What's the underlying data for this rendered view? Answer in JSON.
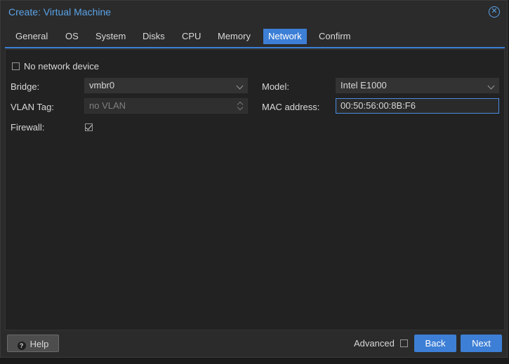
{
  "window": {
    "title": "Create: Virtual Machine",
    "close_icon": "close-circle-icon"
  },
  "tabs": [
    {
      "label": "General"
    },
    {
      "label": "OS"
    },
    {
      "label": "System"
    },
    {
      "label": "Disks"
    },
    {
      "label": "CPU"
    },
    {
      "label": "Memory"
    },
    {
      "label": "Network",
      "active": true
    },
    {
      "label": "Confirm"
    }
  ],
  "form": {
    "no_network_device": {
      "label": "No network device",
      "checked": false
    },
    "bridge": {
      "label": "Bridge:",
      "value": "vmbr0"
    },
    "vlan_tag": {
      "label": "VLAN Tag:",
      "placeholder": "no VLAN"
    },
    "firewall": {
      "label": "Firewall:",
      "checked": true
    },
    "model": {
      "label": "Model:",
      "value": "Intel E1000"
    },
    "mac_address": {
      "label": "MAC address:",
      "value": "00:50:56:00:8B:F6"
    }
  },
  "footer": {
    "help_label": "Help",
    "help_icon": "question-circle-icon",
    "advanced_label": "Advanced",
    "advanced_checked": false,
    "back_label": "Back",
    "next_label": "Next"
  },
  "colors": {
    "accent": "#3d7fd6",
    "title": "#5aa3e8",
    "background": "#2b2b2b"
  }
}
